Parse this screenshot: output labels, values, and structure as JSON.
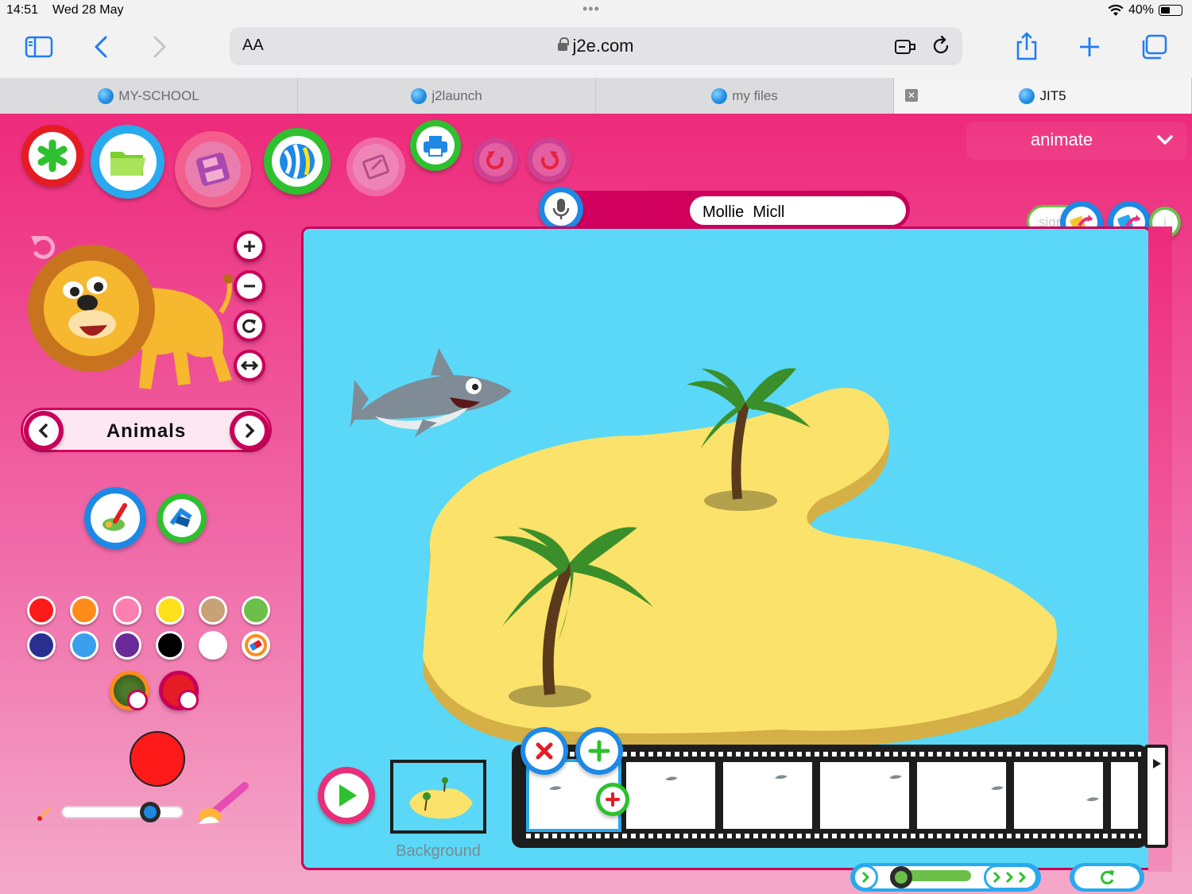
{
  "status": {
    "time": "14:51",
    "date": "Wed 28 May",
    "battery": "40%"
  },
  "browser": {
    "aa_label": "AA",
    "url": "j2e.com",
    "tabs": [
      {
        "label": "MY-SCHOOL"
      },
      {
        "label": "j2launch"
      },
      {
        "label": "my files"
      },
      {
        "label": "JIT5"
      }
    ]
  },
  "app": {
    "mode": "animate",
    "author_name": "Mollie  Micll",
    "sign_placeholder": "sign",
    "info_label": "i",
    "category": "Animals",
    "background_label": "Background",
    "brush_size": 0.73,
    "colors": {
      "palette": [
        "#ff1a1a",
        "#ff8c1a",
        "#ff7fb0",
        "#ffe01a",
        "#c8a277",
        "#6cc04a",
        "#2a2f8f",
        "#3aa0ee",
        "#6a2a9a",
        "#000000",
        "#ffffff"
      ],
      "current": "#ff1a1a",
      "app_pink": "#ee2a7b",
      "canvas_blue": "#5bd8f7"
    },
    "icons": [
      "new-icon",
      "open-folder-icon",
      "save-icon",
      "share-globe-icon",
      "publish-icon",
      "print-icon",
      "undo-icon",
      "redo-icon",
      "microphone-icon",
      "zoom-in-icon",
      "zoom-out-icon",
      "rotate-icon",
      "flip-icon",
      "fill-icon",
      "stamp-icon",
      "eraser-icon",
      "pattern-icon",
      "picker-icon",
      "brush-icon",
      "play-icon",
      "delete-frame-icon",
      "add-frame-icon",
      "loop-icon"
    ],
    "frames_count_visible": 7
  }
}
